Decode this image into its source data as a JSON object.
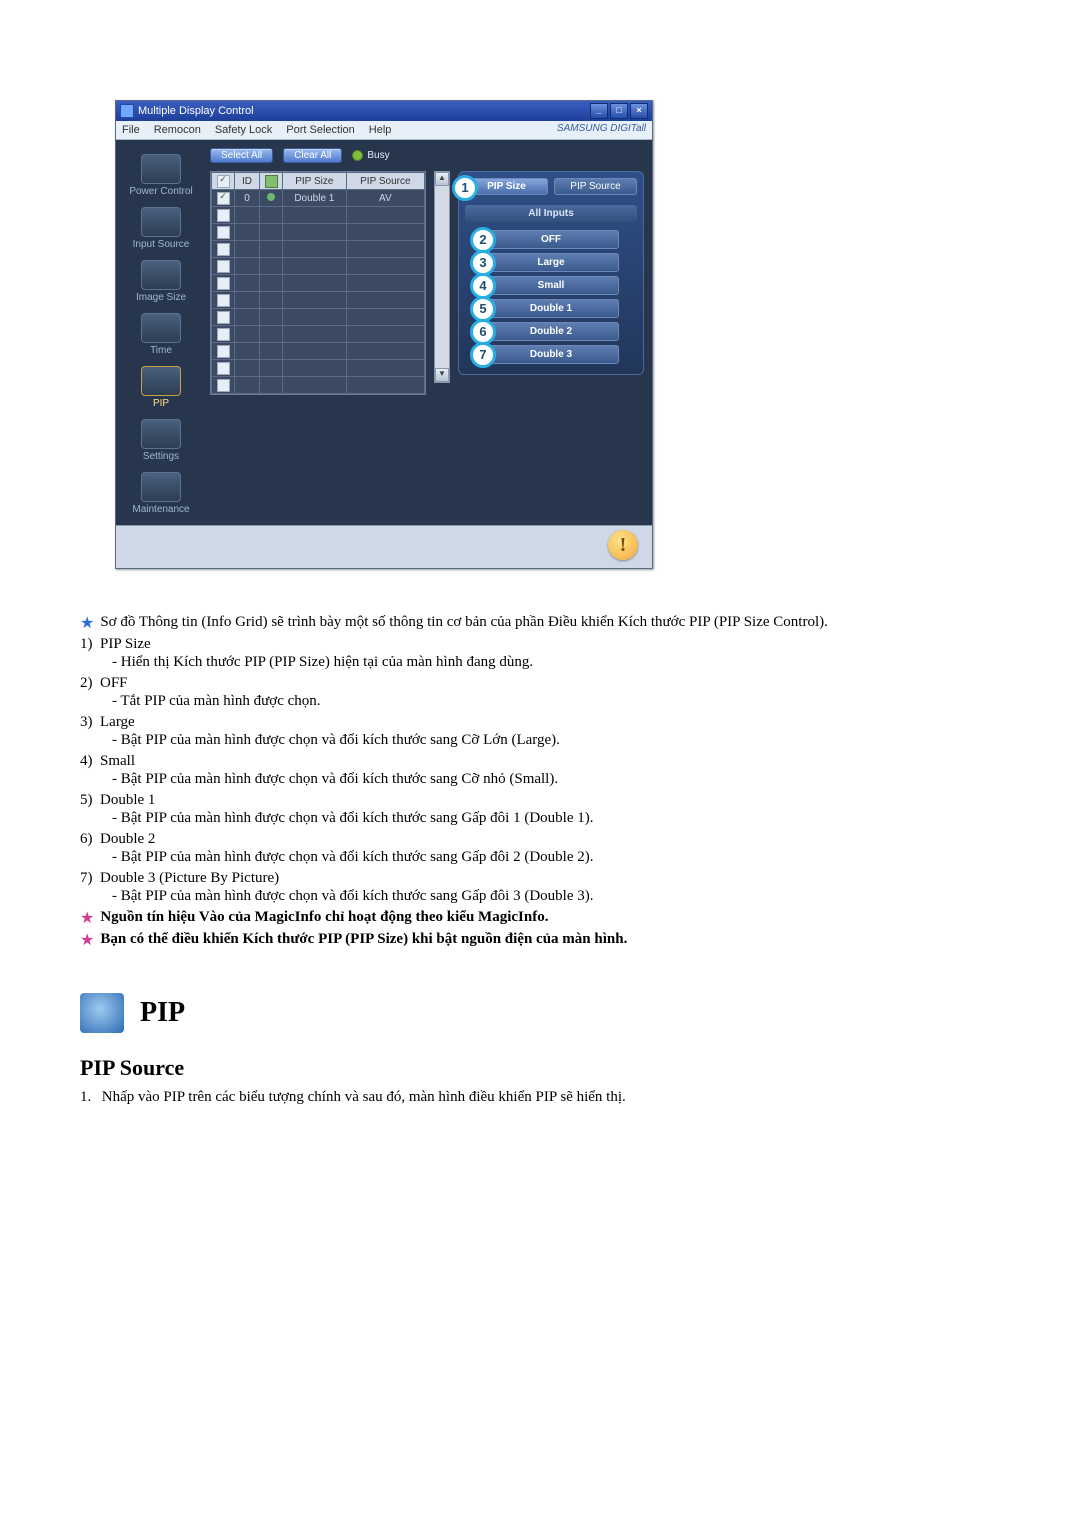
{
  "window": {
    "title": "Multiple Display Control",
    "brand": "SAMSUNG DIGITall",
    "menu": {
      "file": "File",
      "remocon": "Remocon",
      "safety": "Safety Lock",
      "port": "Port Selection",
      "help": "Help"
    },
    "top": {
      "select_all": "Select All",
      "clear_all": "Clear All",
      "busy": "Busy"
    },
    "sidebar": {
      "power": "Power Control",
      "input": "Input Source",
      "image": "Image Size",
      "time": "Time",
      "pip": "PIP",
      "settings": "Settings",
      "maint": "Maintenance"
    },
    "grid": {
      "headers": {
        "chk": "",
        "id": "ID",
        "status": "",
        "pip_size": "PIP Size",
        "pip_source": "PIP Source"
      },
      "row0": {
        "id": "0",
        "pip_size": "Double 1",
        "pip_source": "AV"
      }
    },
    "panel": {
      "tab_size": "PIP Size",
      "tab_source": "PIP Source",
      "header": "All Inputs",
      "options": {
        "off": "OFF",
        "large": "Large",
        "small": "Small",
        "d1": "Double 1",
        "d2": "Double 2",
        "d3": "Double 3"
      },
      "markers": {
        "m1": "1",
        "m2": "2",
        "m3": "3",
        "m4": "4",
        "m5": "5",
        "m6": "6",
        "m7": "7"
      }
    }
  },
  "notes": {
    "intro": "Sơ đồ Thông tin (Info Grid) sẽ trình bày một số thông tin cơ bản của phần Điều khiển Kích thước PIP (PIP Size Control).",
    "warn1": "Nguồn tín hiệu Vào của MagicInfo chỉ hoạt động theo kiểu MagicInfo.",
    "warn2": "Bạn có thể điều khiển Kích thước PIP (PIP Size) khi bật nguồn điện của màn hình."
  },
  "items": {
    "i1": {
      "n": "1)",
      "label": "PIP Size",
      "sub": "- Hiển thị Kích thước PIP (PIP Size) hiện tại của màn hình đang dùng."
    },
    "i2": {
      "n": "2)",
      "label": "OFF",
      "sub": "- Tắt PIP của màn hình được chọn."
    },
    "i3": {
      "n": "3)",
      "label": "Large",
      "sub": "- Bật PIP của màn hình được chọn và đổi kích thước sang Cỡ Lớn (Large)."
    },
    "i4": {
      "n": "4)",
      "label": "Small",
      "sub": "- Bật PIP của màn hình được chọn và đổi kích thước sang Cỡ nhỏ (Small)."
    },
    "i5": {
      "n": "5)",
      "label": "Double 1",
      "sub": "- Bật PIP của màn hình được chọn và đổi kích thước sang Gấp đôi 1 (Double 1)."
    },
    "i6": {
      "n": "6)",
      "label": "Double 2",
      "sub": "- Bật PIP của màn hình được chọn và đổi kích thước sang Gấp đôi 2 (Double 2)."
    },
    "i7": {
      "n": "7)",
      "label": "Double 3 (Picture By Picture)",
      "sub": "- Bật PIP của màn hình được chọn và đổi kích thước sang Gấp đôi 3 (Double 3)."
    }
  },
  "pip_section": {
    "title": "PIP",
    "subtitle": "PIP Source",
    "step1_n": "1.",
    "step1": "Nhấp vào PIP trên các biểu tượng chính và sau đó, màn hình điều khiển PIP sẽ hiển thị."
  }
}
